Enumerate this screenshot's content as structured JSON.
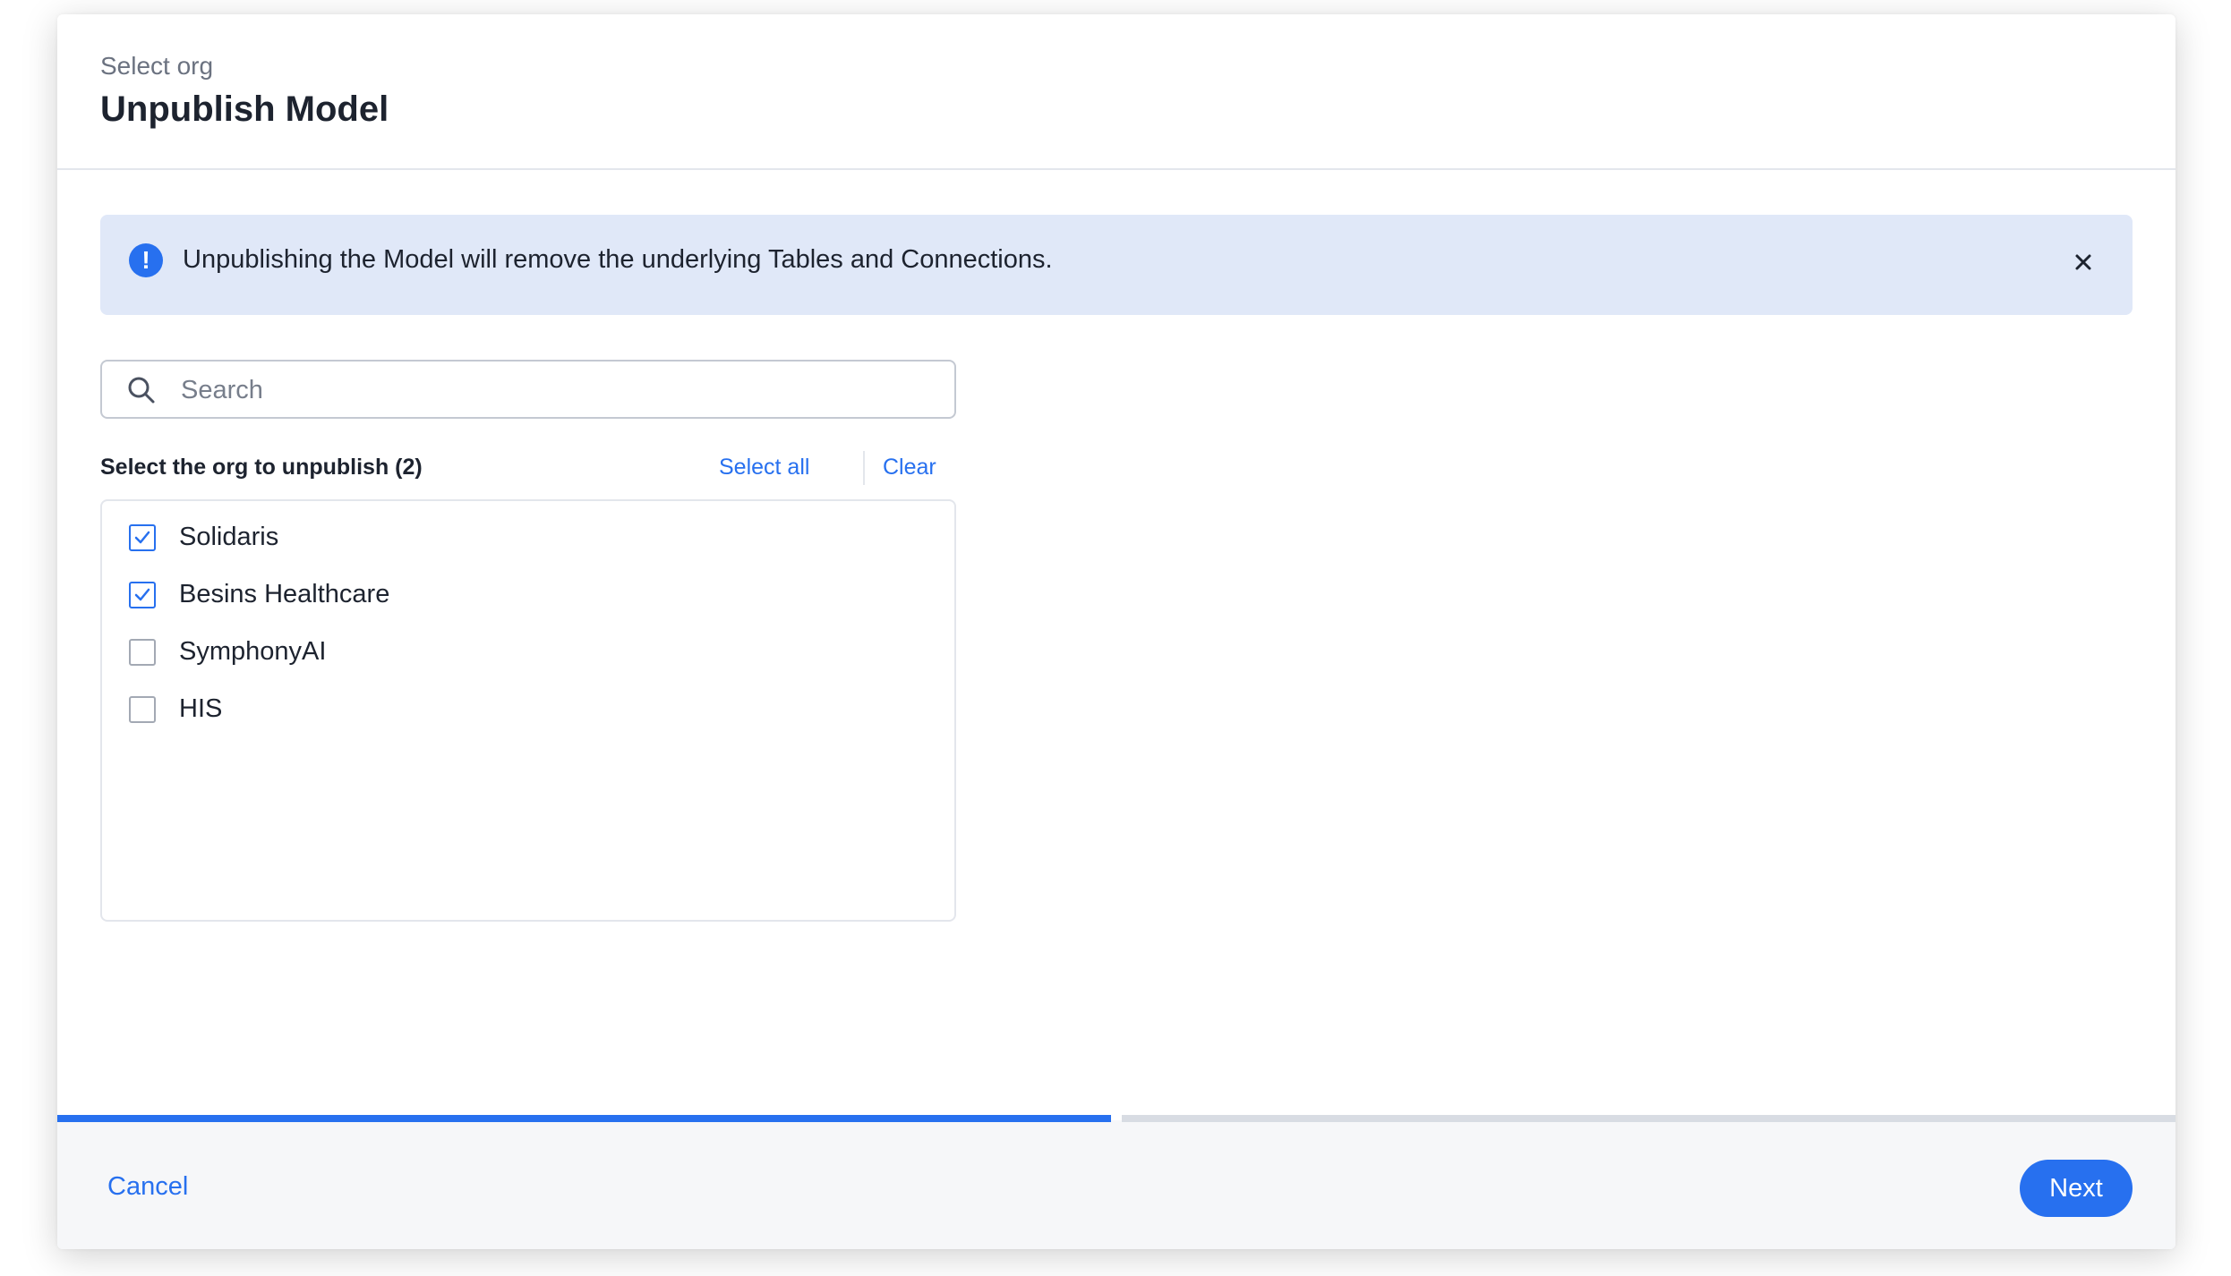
{
  "header": {
    "step_label": "Select org",
    "title": "Unpublish Model"
  },
  "banner": {
    "icon": "info-exclamation-icon",
    "message": "Unpublishing the Model will remove the underlying Tables and Connections.",
    "close_icon": "close-icon"
  },
  "search": {
    "icon": "search-icon",
    "placeholder": "Search",
    "value": ""
  },
  "org_list": {
    "label": "Select the org to unpublish (2)",
    "select_all_label": "Select all",
    "clear_label": "Clear",
    "items": [
      {
        "label": "Solidaris",
        "checked": true
      },
      {
        "label": "Besins Healthcare",
        "checked": true
      },
      {
        "label": "SymphonyAI",
        "checked": false
      },
      {
        "label": "HIS",
        "checked": false
      }
    ]
  },
  "progress": {
    "fraction": 0.5
  },
  "footer": {
    "cancel_label": "Cancel",
    "next_label": "Next"
  },
  "colors": {
    "accent": "#2770ef",
    "banner_bg": "#e0e8f8",
    "footer_bg": "#f6f7f9"
  }
}
